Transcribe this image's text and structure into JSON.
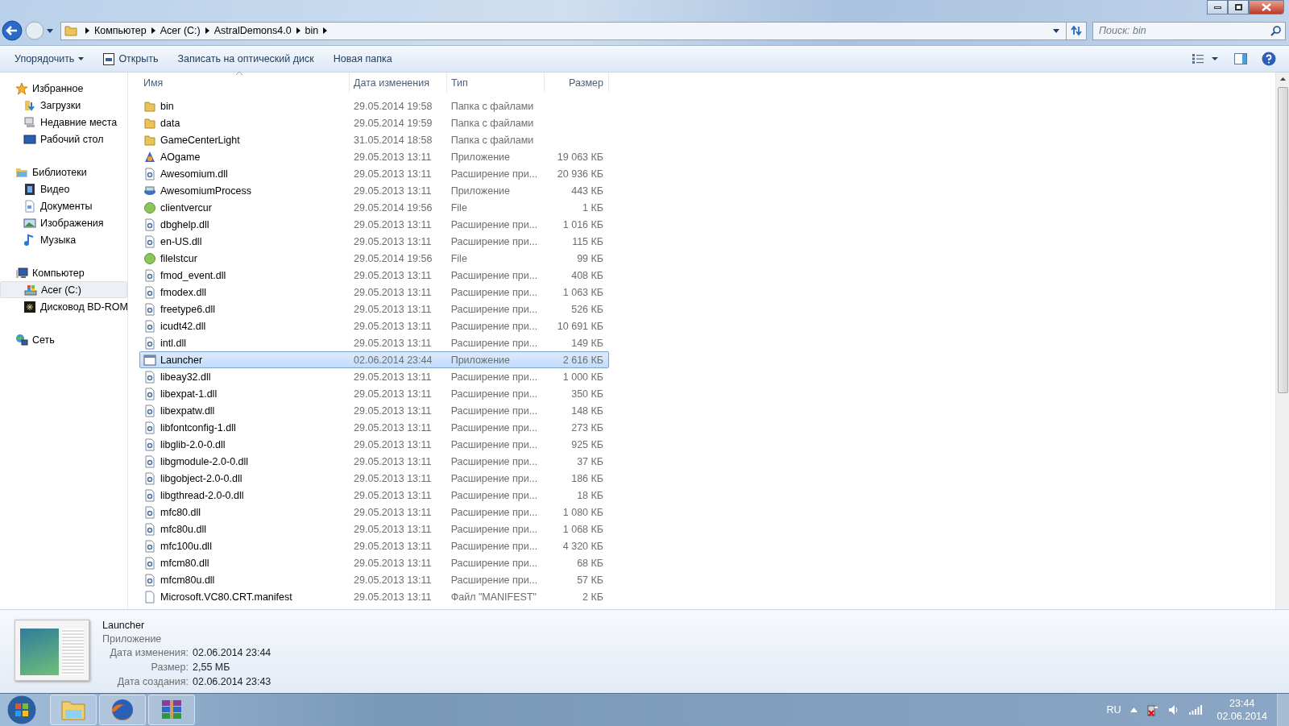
{
  "address": {
    "crumbs": [
      "Компьютер",
      "Acer (C:)",
      "AstralDemons4.0",
      "bin"
    ]
  },
  "search": {
    "placeholder": "Поиск: bin"
  },
  "toolbar": [
    {
      "label": "Упорядочить",
      "dropdown": true,
      "icon": false
    },
    {
      "label": "Открыть",
      "dropdown": false,
      "icon": true
    },
    {
      "label": "Записать на оптический диск",
      "dropdown": false,
      "icon": false
    },
    {
      "label": "Новая папка",
      "dropdown": false,
      "icon": false
    }
  ],
  "sidebar": {
    "groups": [
      {
        "label": "Избранное",
        "kind": "star",
        "children": [
          {
            "label": "Загрузки",
            "kind": "downloads",
            "selected": false
          },
          {
            "label": "Недавние места",
            "kind": "recent",
            "selected": false
          },
          {
            "label": "Рабочий стол",
            "kind": "desktop",
            "selected": false
          }
        ]
      },
      {
        "label": "Библиотеки",
        "kind": "library",
        "children": [
          {
            "label": "Видео",
            "kind": "video",
            "selected": false
          },
          {
            "label": "Документы",
            "kind": "docs",
            "selected": false
          },
          {
            "label": "Изображения",
            "kind": "images",
            "selected": false
          },
          {
            "label": "Музыка",
            "kind": "music",
            "selected": false
          }
        ]
      },
      {
        "label": "Компьютер",
        "kind": "computer",
        "children": [
          {
            "label": "Acer (C:)",
            "kind": "drive",
            "selected": true
          },
          {
            "label": "Дисковод BD-ROM",
            "kind": "bdrom",
            "selected": false
          }
        ]
      },
      {
        "label": "Сеть",
        "kind": "network"
      }
    ]
  },
  "table": {
    "columns": [
      "Имя",
      "Дата изменения",
      "Тип",
      "Размер"
    ],
    "rows": [
      {
        "kind": "folder",
        "name": "bin",
        "date": "29.05.2014 19:58",
        "type": "Папка с файлами",
        "selected": false
      },
      {
        "kind": "folder",
        "name": "data",
        "date": "29.05.2014 19:59",
        "type": "Папка с файлами",
        "selected": false
      },
      {
        "kind": "folder",
        "name": "GameCenterLight",
        "date": "31.05.2014 18:58",
        "type": "Папка с файлами",
        "selected": false
      },
      {
        "kind": "app",
        "name": "AOgame",
        "date": "29.05.2013 13:11",
        "type": "Приложение",
        "size": "19 063 КБ",
        "selected": false
      },
      {
        "kind": "dll",
        "name": "Awesomium.dll",
        "date": "29.05.2013 13:11",
        "type": "Расширение при...",
        "size": "20 936 КБ",
        "selected": false
      },
      {
        "kind": "app2",
        "name": "AwesomiumProcess",
        "date": "29.05.2013 13:11",
        "type": "Приложение",
        "size": "443 КБ",
        "selected": false
      },
      {
        "kind": "file",
        "name": "clientvercur",
        "date": "29.05.2014 19:56",
        "type": "File",
        "size": "1 КБ",
        "selected": false
      },
      {
        "kind": "dll",
        "name": "dbghelp.dll",
        "date": "29.05.2013 13:11",
        "type": "Расширение при...",
        "size": "1 016 КБ",
        "selected": false
      },
      {
        "kind": "dll",
        "name": "en-US.dll",
        "date": "29.05.2013 13:11",
        "type": "Расширение при...",
        "size": "115 КБ",
        "selected": false
      },
      {
        "kind": "file",
        "name": "filelstcur",
        "date": "29.05.2014 19:56",
        "type": "File",
        "size": "99 КБ",
        "selected": false
      },
      {
        "kind": "dll",
        "name": "fmod_event.dll",
        "date": "29.05.2013 13:11",
        "type": "Расширение при...",
        "size": "408 КБ",
        "selected": false
      },
      {
        "kind": "dll",
        "name": "fmodex.dll",
        "date": "29.05.2013 13:11",
        "type": "Расширение при...",
        "size": "1 063 КБ",
        "selected": false
      },
      {
        "kind": "dll",
        "name": "freetype6.dll",
        "date": "29.05.2013 13:11",
        "type": "Расширение при...",
        "size": "526 КБ",
        "selected": false
      },
      {
        "kind": "dll",
        "name": "icudt42.dll",
        "date": "29.05.2013 13:11",
        "type": "Расширение при...",
        "size": "10 691 КБ",
        "selected": false
      },
      {
        "kind": "dll",
        "name": "intl.dll",
        "date": "29.05.2013 13:11",
        "type": "Расширение при...",
        "size": "149 КБ",
        "selected": false
      },
      {
        "kind": "window",
        "name": "Launcher",
        "date": "02.06.2014 23:44",
        "type": "Приложение",
        "size": "2 616 КБ",
        "selected": true
      },
      {
        "kind": "dll",
        "name": "libeay32.dll",
        "date": "29.05.2013 13:11",
        "type": "Расширение при...",
        "size": "1 000 КБ",
        "selected": false
      },
      {
        "kind": "dll",
        "name": "libexpat-1.dll",
        "date": "29.05.2013 13:11",
        "type": "Расширение при...",
        "size": "350 КБ",
        "selected": false
      },
      {
        "kind": "dll",
        "name": "libexpatw.dll",
        "date": "29.05.2013 13:11",
        "type": "Расширение при...",
        "size": "148 КБ",
        "selected": false
      },
      {
        "kind": "dll",
        "name": "libfontconfig-1.dll",
        "date": "29.05.2013 13:11",
        "type": "Расширение при...",
        "size": "273 КБ",
        "selected": false
      },
      {
        "kind": "dll",
        "name": "libglib-2.0-0.dll",
        "date": "29.05.2013 13:11",
        "type": "Расширение при...",
        "size": "925 КБ",
        "selected": false
      },
      {
        "kind": "dll",
        "name": "libgmodule-2.0-0.dll",
        "date": "29.05.2013 13:11",
        "type": "Расширение при...",
        "size": "37 КБ",
        "selected": false
      },
      {
        "kind": "dll",
        "name": "libgobject-2.0-0.dll",
        "date": "29.05.2013 13:11",
        "type": "Расширение при...",
        "size": "186 КБ",
        "selected": false
      },
      {
        "kind": "dll",
        "name": "libgthread-2.0-0.dll",
        "date": "29.05.2013 13:11",
        "type": "Расширение при...",
        "size": "18 КБ",
        "selected": false
      },
      {
        "kind": "dll",
        "name": "mfc80.dll",
        "date": "29.05.2013 13:11",
        "type": "Расширение при...",
        "size": "1 080 КБ",
        "selected": false
      },
      {
        "kind": "dll",
        "name": "mfc80u.dll",
        "date": "29.05.2013 13:11",
        "type": "Расширение при...",
        "size": "1 068 КБ",
        "selected": false
      },
      {
        "kind": "dll",
        "name": "mfc100u.dll",
        "date": "29.05.2013 13:11",
        "type": "Расширение при...",
        "size": "4 320 КБ",
        "selected": false
      },
      {
        "kind": "dll",
        "name": "mfcm80.dll",
        "date": "29.05.2013 13:11",
        "type": "Расширение при...",
        "size": "68 КБ",
        "selected": false
      },
      {
        "kind": "dll",
        "name": "mfcm80u.dll",
        "date": "29.05.2013 13:11",
        "type": "Расширение при...",
        "size": "57 КБ",
        "selected": false
      },
      {
        "kind": "doc",
        "name": "Microsoft.VC80.CRT.manifest",
        "date": "29.05.2013 13:11",
        "type": "Файл \"MANIFEST\"",
        "size": "2 КБ",
        "selected": false
      }
    ]
  },
  "details": {
    "name": "Launcher",
    "type": "Приложение",
    "props": [
      {
        "label": "Дата изменения:",
        "value": "02.06.2014 23:44"
      },
      {
        "label": "Размер:",
        "value": "2,55 МБ"
      },
      {
        "label": "Дата создания:",
        "value": "02.06.2014 23:43"
      }
    ]
  },
  "taskbar": {
    "apps": [
      {
        "kind": "folder"
      },
      {
        "kind": "firefox"
      },
      {
        "kind": "archive"
      }
    ],
    "language": "RU",
    "time": "23:44",
    "date": "02.06.2014"
  }
}
